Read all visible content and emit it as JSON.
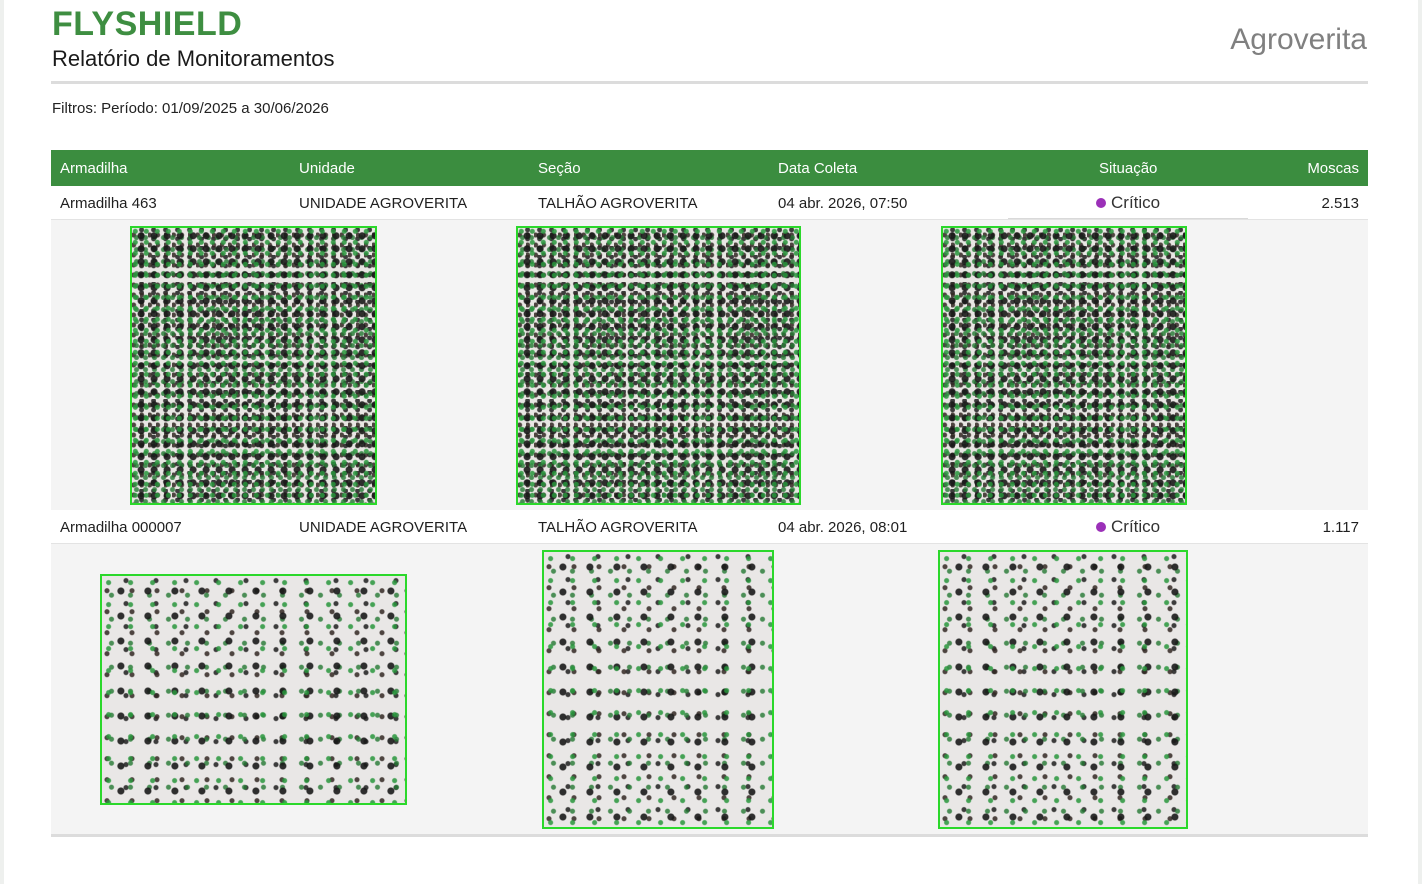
{
  "header": {
    "brand": "FLYSHIELD",
    "report_title": "Relatório de Monitoramentos",
    "client": "Agroverita"
  },
  "filters": "Filtros: Período: 01/09/2025 a 30/06/2026",
  "table": {
    "columns": [
      "Armadilha",
      "Unidade",
      "Seção",
      "Data Coleta",
      "Situação",
      "Moscas"
    ],
    "rows": [
      {
        "armadilha": "Armadilha 463",
        "unidade": "UNIDADE AGROVERITA",
        "secao": "TALHÃO AGROVERITA",
        "data_coleta": "04 abr. 2026, 07:50",
        "situacao": "Crítico",
        "moscas": "2.513"
      },
      {
        "armadilha": "Armadilha 000007",
        "unidade": "UNIDADE AGROVERITA",
        "secao": "TALHÃO AGROVERITA",
        "data_coleta": "04 abr. 2026, 08:01",
        "situacao": "Crítico",
        "moscas": "1.117"
      }
    ]
  },
  "colors": {
    "brand": "#3e8e41",
    "table_header": "#3b8d3f",
    "status_critical": "#9b30b8",
    "detection_box": "#2bd82b"
  }
}
